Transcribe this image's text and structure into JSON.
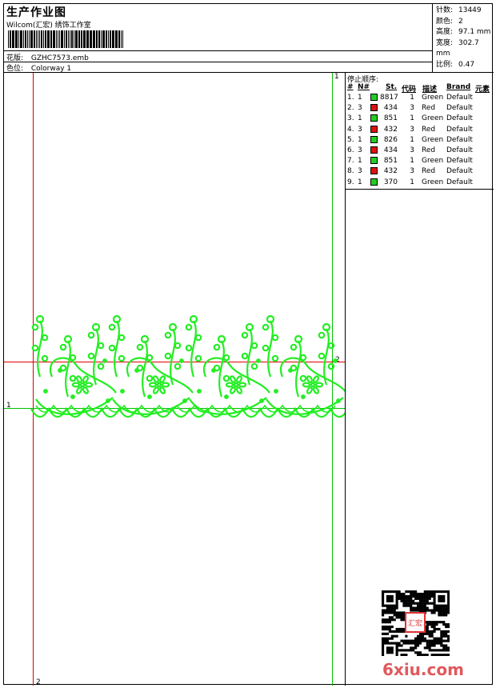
{
  "header": {
    "title": "生产作业图",
    "subtitle": "Wilcom(汇宏) 绣饰工作室",
    "design_label": "花版:",
    "design_value": "GZHC7573.emb",
    "colorway_label": "色位:",
    "colorway_value": "Colorway 1"
  },
  "stats": [
    {
      "label": "针数:",
      "value": "13449"
    },
    {
      "label": "颜色:",
      "value": "2"
    },
    {
      "label": "高度:",
      "value": "97.1 mm"
    },
    {
      "label": "宽度:",
      "value": "302.7 mm"
    },
    {
      "label": "比例:",
      "value": "0.47"
    }
  ],
  "guides": {
    "label_1": "1",
    "label_2": "2",
    "colors": {
      "red": "#e00000",
      "green": "#00c000"
    }
  },
  "stop_sequence": {
    "title": "停止顺序:",
    "headers": {
      "num": "#",
      "n": "N#",
      "st": "St.",
      "code": "代码",
      "desc": "描述",
      "brand": "Brand",
      "elem": "元素"
    },
    "rows": [
      {
        "num": "1.",
        "n": "1",
        "color": "#22cc22",
        "st": "8817",
        "code": "1",
        "desc": "Green",
        "brand": "Default"
      },
      {
        "num": "2.",
        "n": "3",
        "color": "#dd1111",
        "st": "434",
        "code": "3",
        "desc": "Red",
        "brand": "Default"
      },
      {
        "num": "3.",
        "n": "1",
        "color": "#22cc22",
        "st": "851",
        "code": "1",
        "desc": "Green",
        "brand": "Default"
      },
      {
        "num": "4.",
        "n": "3",
        "color": "#dd1111",
        "st": "432",
        "code": "3",
        "desc": "Red",
        "brand": "Default"
      },
      {
        "num": "5.",
        "n": "1",
        "color": "#22cc22",
        "st": "826",
        "code": "1",
        "desc": "Green",
        "brand": "Default"
      },
      {
        "num": "6.",
        "n": "3",
        "color": "#dd1111",
        "st": "434",
        "code": "3",
        "desc": "Red",
        "brand": "Default"
      },
      {
        "num": "7.",
        "n": "1",
        "color": "#22cc22",
        "st": "851",
        "code": "1",
        "desc": "Green",
        "brand": "Default"
      },
      {
        "num": "8.",
        "n": "3",
        "color": "#dd1111",
        "st": "432",
        "code": "3",
        "desc": "Red",
        "brand": "Default"
      },
      {
        "num": "9.",
        "n": "1",
        "color": "#22cc22",
        "st": "370",
        "code": "1",
        "desc": "Green",
        "brand": "Default"
      }
    ]
  },
  "embroidery_color": "#22ee22",
  "watermark": "6xiu.com",
  "seal_text": "汇宏"
}
